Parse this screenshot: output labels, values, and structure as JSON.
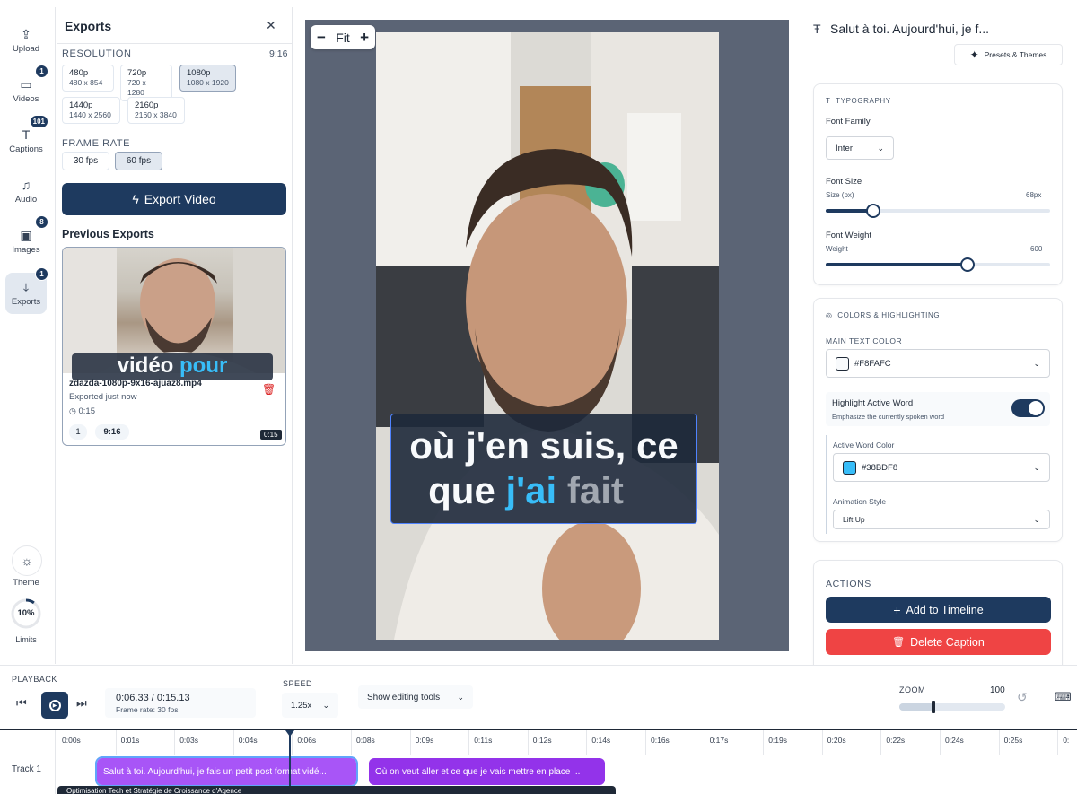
{
  "rail": {
    "items": [
      {
        "label": "Upload",
        "icon": "upload-icon",
        "glyph": "⇪",
        "badge": ""
      },
      {
        "label": "Videos",
        "icon": "video-icon",
        "glyph": "▭",
        "badge": "1"
      },
      {
        "label": "Captions",
        "icon": "text-icon",
        "glyph": "T",
        "badge": "101"
      },
      {
        "label": "Audio",
        "icon": "music-icon",
        "glyph": "♫",
        "badge": ""
      },
      {
        "label": "Images",
        "icon": "image-icon",
        "glyph": "▣",
        "badge": "8"
      },
      {
        "label": "Exports",
        "icon": "download-icon",
        "glyph": "⤓",
        "badge": "1"
      }
    ],
    "theme_label": "Theme",
    "limits_label": "Limits",
    "limits_value": "10%",
    "limits_fraction": 0.1
  },
  "exports": {
    "title": "Exports",
    "resolution_label": "RESOLUTION",
    "aspect": "9:16",
    "resolutions": [
      {
        "name": "480p",
        "dims": "480 x 854"
      },
      {
        "name": "720p",
        "dims": "720 x 1280"
      },
      {
        "name": "1080p",
        "dims": "1080 x 1920"
      },
      {
        "name": "1440p",
        "dims": "1440 x 2560"
      },
      {
        "name": "2160p",
        "dims": "2160 x 3840"
      }
    ],
    "selected_resolution": "1080p",
    "frame_rate_label": "FRAME RATE",
    "frame_rates": [
      "30 fps",
      "60 fps"
    ],
    "selected_fps": "60 fps",
    "export_button": "Export Video",
    "previous_label": "Previous Exports",
    "previous": {
      "thumb_caption_white": "vidéo",
      "thumb_caption_blue": "pour",
      "filename": "zdazda-1080p-9x16-ajuaz8.mp4",
      "status": "Exported just now",
      "duration": "0:15",
      "tag_count": "1",
      "tag_aspect": "9:16",
      "duration_badge": "0:15"
    }
  },
  "canvas": {
    "zoom_label": "Fit",
    "caption_line1": "où j'en suis, ce",
    "caption_line2_a": "que",
    "caption_line2_b": "j'ai",
    "caption_line2_c": "fait",
    "bg_color": "#5b6475",
    "highlight_color": "#38BDF8"
  },
  "inspector": {
    "caption_title": "Salut à toi. Aujourd'hui, je f...",
    "presets_button": "Presets & Themes",
    "typography_label": "TYPOGRAPHY",
    "font_family_label": "Font Family",
    "font_family_value": "Inter",
    "font_size_label": "Font Size",
    "size_sub": "Size (px)",
    "size_value": "68px",
    "size_fraction": 0.21,
    "font_weight_label": "Font Weight",
    "weight_sub": "Weight",
    "weight_value": "600",
    "weight_fraction": 0.63,
    "colors_label": "COLORS & HIGHLIGHTING",
    "main_text_color_label": "MAIN TEXT COLOR",
    "main_text_color": "#F8FAFC",
    "highlight_label": "Highlight Active Word",
    "highlight_sub": "Emphasize the currently spoken word",
    "highlight_on": true,
    "active_word_color_label": "Active Word Color",
    "active_word_color": "#38BDF8",
    "animation_label": "Animation Style",
    "animation_value": "Lift Up",
    "actions_label": "ACTIONS",
    "add_button": "Add to Timeline",
    "delete_button": "Delete Caption"
  },
  "playback": {
    "label": "PLAYBACK",
    "time": "0:06.33 / 0:15.13",
    "frame_rate": "Frame rate: 30 fps",
    "speed_label": "SPEED",
    "speed_value": "1.25x",
    "editing_tools": "Show editing tools",
    "zoom_label": "ZOOM",
    "zoom_value": "100",
    "zoom_fraction": 0.32
  },
  "timeline": {
    "ticks": [
      "0:00s",
      "0:01s",
      "0:03s",
      "0:04s",
      "0:06s",
      "0:08s",
      "0:09s",
      "0:11s",
      "0:12s",
      "0:14s",
      "0:16s",
      "0:17s",
      "0:19s",
      "0:20s",
      "0:22s",
      "0:24s",
      "0:25s",
      "0:"
    ],
    "track_label": "Track 1",
    "clips": [
      "Salut à toi. Aujourd'hui, je fais un petit post format vidé...",
      "Où on veut aller et ce que je vais mettre en place ..."
    ],
    "bottom_text": "Optimisation Tech et Stratégie de Croissance d'Agence",
    "clip_color": "#9333ea"
  }
}
